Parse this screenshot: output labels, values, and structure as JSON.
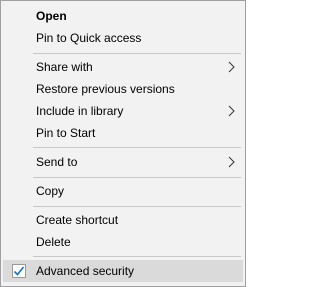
{
  "menu": {
    "items": {
      "open": "Open",
      "pin_quick_access": "Pin to Quick access",
      "share_with": "Share with",
      "restore_previous": "Restore previous versions",
      "include_in_library": "Include in library",
      "pin_to_start": "Pin to Start",
      "send_to": "Send to",
      "copy": "Copy",
      "create_shortcut": "Create shortcut",
      "delete": "Delete",
      "advanced_security": "Advanced security"
    },
    "icons": {
      "submenu": "chevron-right-icon",
      "advanced_security": "checkmark-icon"
    },
    "colors": {
      "background": "#f2f2f2",
      "border": "#a0a0a0",
      "highlight": "#dadada",
      "separator": "#c8c8c8",
      "check_icon": "#1a6fc9"
    }
  }
}
